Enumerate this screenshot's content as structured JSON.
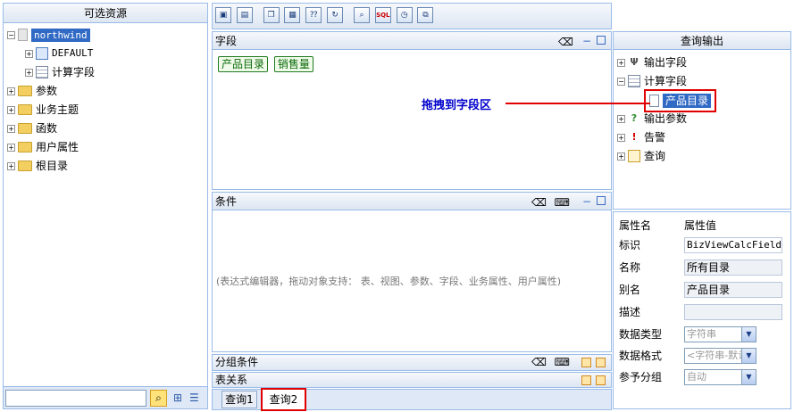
{
  "left": {
    "title": "可选资源",
    "tree": [
      {
        "label": "northwind"
      },
      {
        "label": "DEFAULT"
      },
      {
        "label": "计算字段"
      },
      {
        "label": "参数"
      },
      {
        "label": "业务主题"
      },
      {
        "label": "函数"
      },
      {
        "label": "用户属性"
      },
      {
        "label": "根目录"
      }
    ],
    "search_value": ""
  },
  "toolbar": {
    "buttons": [
      "save-icon",
      "save-as-icon",
      "window-icon",
      "table-icon",
      "param-icon",
      "refresh-icon",
      "search-icon",
      "sql-icon",
      "clock-icon",
      "export-icon"
    ],
    "sql_label": "SQL"
  },
  "fields": {
    "title": "字段",
    "chips": [
      "产品目录",
      "销售量"
    ]
  },
  "conditions": {
    "title": "条件",
    "hint": "(表达式编辑器，拖动对象支持：  表、视图、参数、字段、业务属性、用户属性)"
  },
  "group": {
    "title": "分组条件"
  },
  "relation": {
    "title": "表关系"
  },
  "tabs": [
    {
      "label": "查询1"
    },
    {
      "label": "查询2"
    }
  ],
  "output": {
    "title": "查询输出",
    "tree": [
      {
        "label": "输出字段"
      },
      {
        "label": "计算字段"
      },
      {
        "label": "产品目录"
      },
      {
        "label": "输出参数"
      },
      {
        "label": "告警"
      },
      {
        "label": "查询"
      }
    ]
  },
  "annotation": {
    "text": "拖拽到字段区"
  },
  "props": {
    "header_name": "属性名",
    "header_value": "属性值",
    "rows": [
      {
        "name": "标识",
        "value": "BizViewCalcField"
      },
      {
        "name": "名称",
        "value": "所有目录"
      },
      {
        "name": "别名",
        "value": "产品目录"
      },
      {
        "name": "描述",
        "value": ""
      },
      {
        "name": "数据类型",
        "value": "字符串"
      },
      {
        "name": "数据格式",
        "value": "<字符串-默认>"
      },
      {
        "name": "参予分组",
        "value": "自动"
      }
    ]
  },
  "colors": {
    "accent": "#99bbe8",
    "highlight": "#e00000",
    "selection": "#316ac5",
    "annotation": "#0000cc"
  }
}
